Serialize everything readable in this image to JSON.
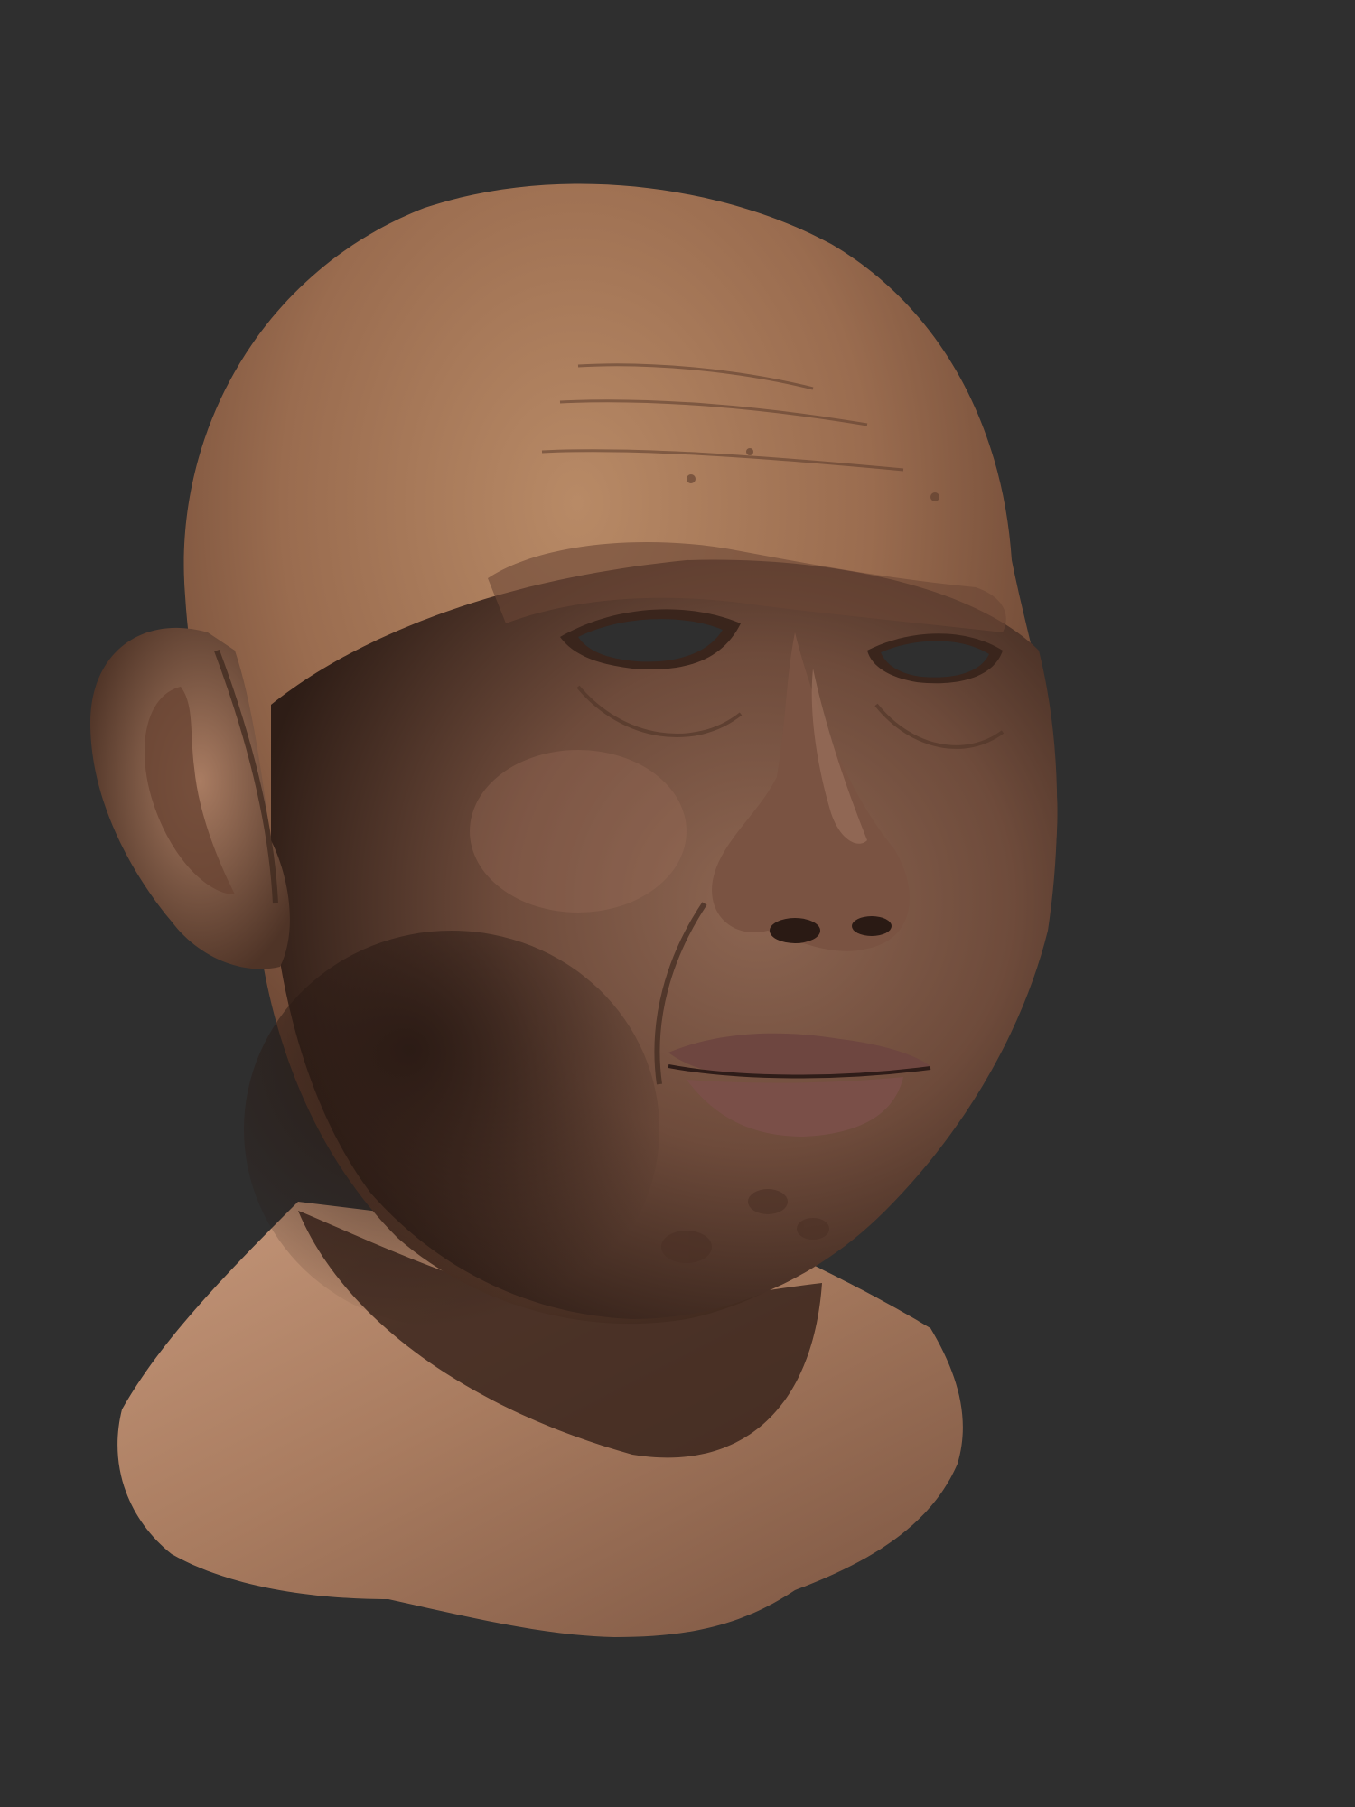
{
  "scene": {
    "background_color": "#2f2f2f",
    "subject": "sculpted-head-render",
    "colors": {
      "skin_light": "#b88a66",
      "skin_mid": "#8e6449",
      "skin_shadow": "#4a2f22",
      "skin_deep_shadow": "#2a1a14",
      "lip": "#7a4f48",
      "eye_socket_void": "#2f2f2f"
    }
  }
}
